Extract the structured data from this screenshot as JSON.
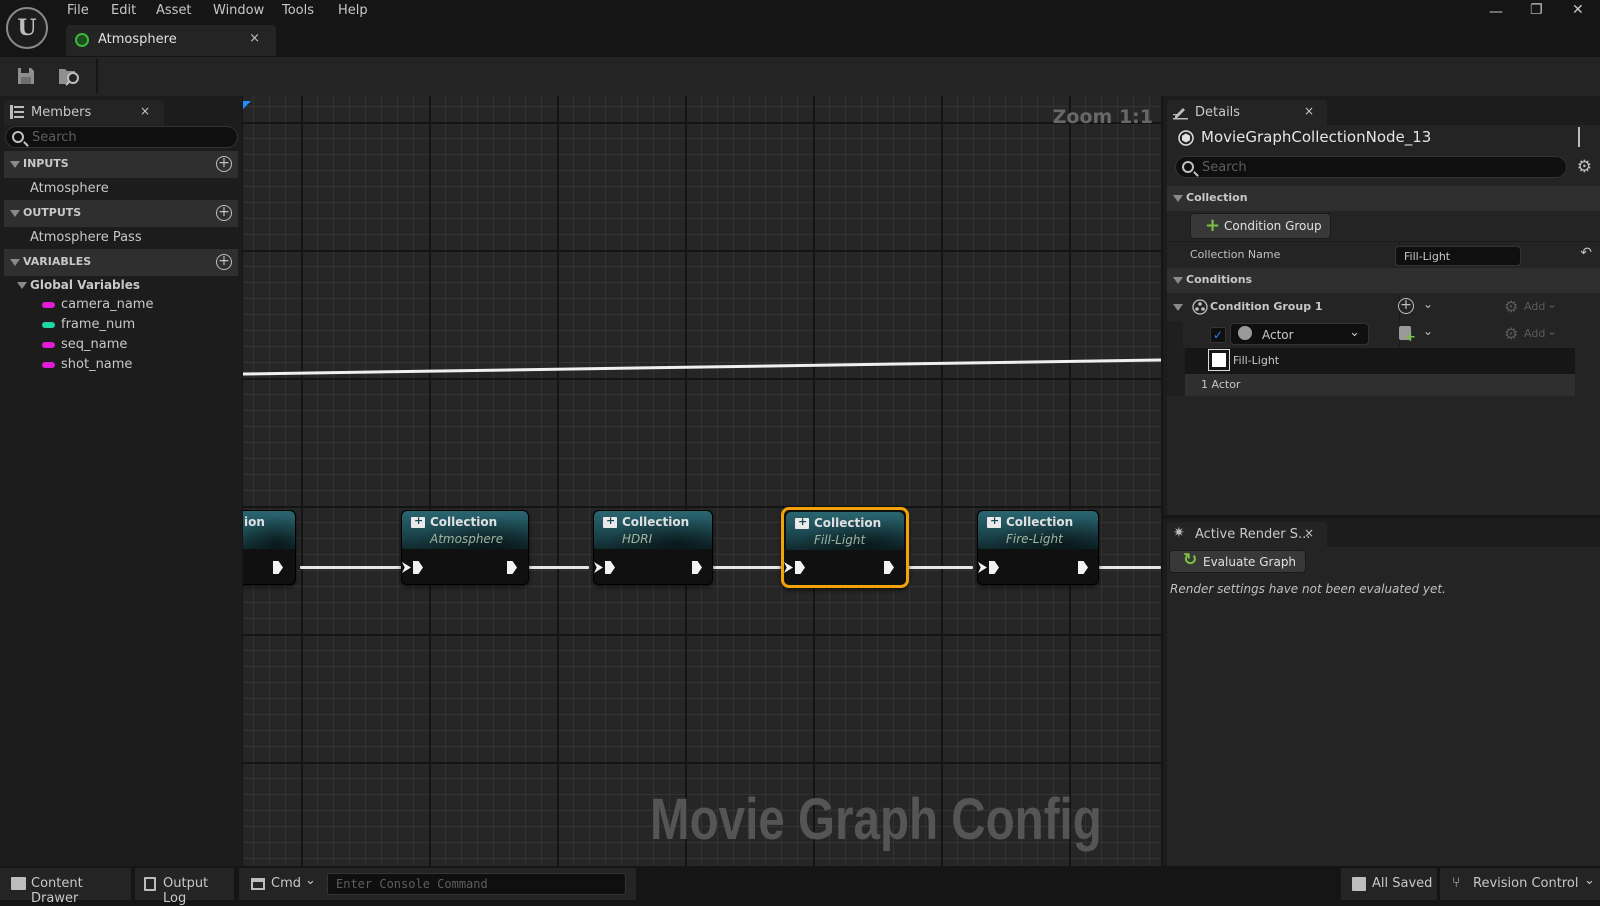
{
  "window": {
    "menu": [
      "File",
      "Edit",
      "Asset",
      "Window",
      "Tools",
      "Help"
    ],
    "document_tab": {
      "label": "Atmosphere",
      "close": "×"
    },
    "controls": {
      "minimize": "—",
      "restore": "❐",
      "close": "✕"
    }
  },
  "toolbar": {
    "icons": [
      "save-icon",
      "browse-to-asset-icon"
    ]
  },
  "members": {
    "tab_label": "Members",
    "close": "×",
    "search_placeholder": "Search",
    "sections": [
      {
        "label": "INPUTS",
        "items": [
          "Atmosphere"
        ]
      },
      {
        "label": "OUTPUTS",
        "items": [
          "Atmosphere Pass"
        ]
      },
      {
        "label": "VARIABLES",
        "groups": [
          {
            "label": "Global Variables",
            "items": [
              {
                "name": "camera_name",
                "color": "#e21bd6"
              },
              {
                "name": "frame_num",
                "color": "#1fd6a6"
              },
              {
                "name": "seq_name",
                "color": "#e21bd6"
              },
              {
                "name": "shot_name",
                "color": "#e21bd6"
              }
            ]
          }
        ]
      }
    ]
  },
  "graph": {
    "zoom_label": "Zoom 1:1",
    "watermark": "Movie Graph Config",
    "nodes": [
      {
        "title": "Collection",
        "subtitle": "",
        "partial_title": "ion",
        "selected": false
      },
      {
        "title": "Collection",
        "subtitle": "Atmosphere",
        "selected": false
      },
      {
        "title": "Collection",
        "subtitle": "HDRI",
        "selected": false
      },
      {
        "title": "Collection",
        "subtitle": "Fill-Light",
        "selected": true
      },
      {
        "title": "Collection",
        "subtitle": "Fire-Light",
        "selected": false
      }
    ],
    "selection_color": "#f3a20c"
  },
  "details": {
    "tab_label": "Details",
    "close": "×",
    "object_name": "MovieGraphCollectionNode_13",
    "search_placeholder": "Search",
    "collection_section": "Collection",
    "add_condition_group": "Condition Group",
    "collection_name_label": "Collection Name",
    "collection_name_value": "Fill-Light",
    "conditions_section": "Conditions",
    "condition_group_label": "Condition Group 1",
    "add_label": "Add",
    "condition_enabled": true,
    "condition_type": "Actor",
    "result_item": "Fill-Light",
    "result_count": "1 Actor"
  },
  "active_render_settings": {
    "tab_label": "Active Render S...",
    "close": "×",
    "evaluate_button": "Evaluate Graph",
    "message": "Render settings have not been evaluated yet."
  },
  "statusbar": {
    "content_drawer": "Content Drawer",
    "output_log": "Output Log",
    "cmd": "Cmd",
    "console_placeholder": "Enter Console Command",
    "save_status": "All Saved",
    "revision_control": "Revision Control"
  }
}
